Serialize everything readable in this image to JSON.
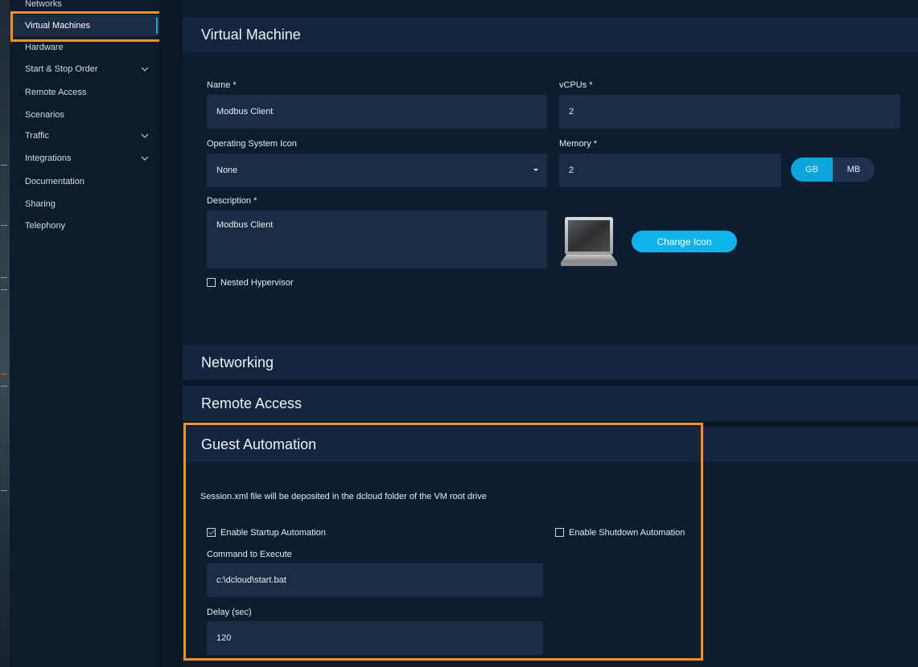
{
  "sidebar": {
    "items": [
      {
        "label": "Networks"
      },
      {
        "label": "Virtual Machines"
      },
      {
        "label": "Hardware"
      },
      {
        "label": "Start & Stop Order"
      },
      {
        "label": "Remote Access"
      },
      {
        "label": "Scenarios"
      },
      {
        "label": "Traffic"
      },
      {
        "label": "Integrations"
      },
      {
        "label": "Documentation"
      },
      {
        "label": "Sharing"
      },
      {
        "label": "Telephony"
      }
    ]
  },
  "vm": {
    "title": "Virtual Machine",
    "name_label": "Name *",
    "name_value": "Modbus Client",
    "vcpus_label": "vCPUs *",
    "vcpus_value": "2",
    "os_icon_label": "Operating System Icon",
    "os_icon_value": "None",
    "memory_label": "Memory *",
    "memory_value": "2",
    "unit_gb": "GB",
    "unit_mb": "MB",
    "description_label": "Description *",
    "description_value": "Modbus Client",
    "change_icon_label": "Change Icon",
    "nested_hypervisor_label": "Nested Hypervisor"
  },
  "networking": {
    "title": "Networking"
  },
  "remote_access": {
    "title": "Remote Access"
  },
  "guest_automation": {
    "title": "Guest Automation",
    "info": "Session.xml file will be deposited in the dcloud folder of the VM root drive",
    "startup_label": "Enable Startup Automation",
    "shutdown_label": "Enable Shutdown Automation",
    "command_label": "Command to Execute",
    "command_value": "c:\\dcloud\\start.bat",
    "delay_label": "Delay (sec)",
    "delay_value": "120"
  },
  "colors": {
    "accent": "#0fb3ec",
    "highlight": "#f7921e"
  }
}
